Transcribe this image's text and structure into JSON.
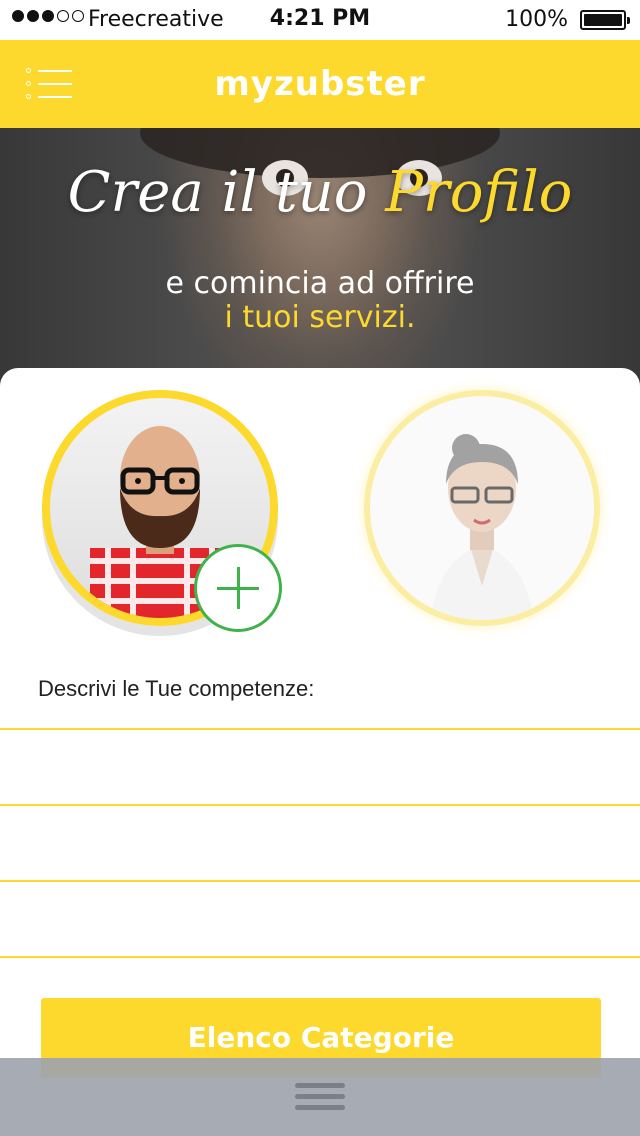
{
  "status": {
    "carrier": "Freecreative",
    "time": "4:21 PM",
    "battery": "100%",
    "signal_bars_filled": 3,
    "signal_bars_total": 5
  },
  "nav": {
    "title": "myzubster",
    "menu_icon": "list-menu-icon"
  },
  "hero": {
    "title_part1": "Crea il tuo ",
    "title_part2": "Profilo",
    "subtitle_line1": "e comincia ad offrire",
    "subtitle_line2": "i tuoi servizi."
  },
  "avatars": [
    {
      "name": "avatar-male",
      "selected": true
    },
    {
      "name": "avatar-female",
      "selected": false
    }
  ],
  "form": {
    "label": "Descrivi le Tue competenze:",
    "fields": [
      "",
      "",
      ""
    ]
  },
  "cta": {
    "label": "Elenco Categorie"
  },
  "colors": {
    "accent": "#fcd92c",
    "add": "#3fb24a",
    "bottom_bar": "#a0a4ac"
  }
}
